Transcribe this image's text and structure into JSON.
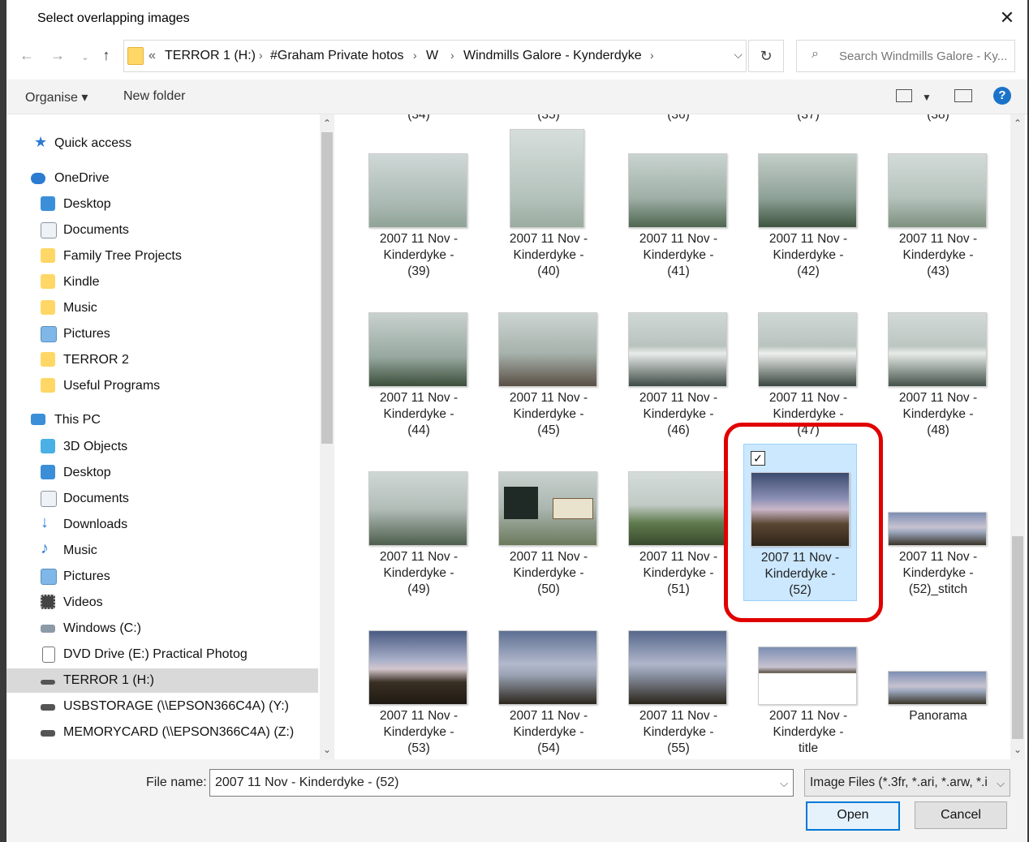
{
  "window": {
    "title": "Select overlapping images",
    "close_glyph": "✕"
  },
  "address_bar": {
    "overflow": "«",
    "crumbs": [
      "TERROR 1 (H:)",
      "#Graham Private hotos",
      "W",
      "Windmills Galore - Kynderdyke"
    ],
    "separator": "›"
  },
  "search": {
    "placeholder": "Search Windmills Galore - Ky..."
  },
  "toolbar": {
    "organise_label": "Organise ▾",
    "new_folder_label": "New folder",
    "help_label": "?"
  },
  "nav": {
    "items": [
      {
        "label": "Quick access",
        "icon": "star-icon"
      },
      {
        "label": "OneDrive",
        "icon": "cloud-icon"
      },
      {
        "label": "Desktop",
        "icon": "desktop-icon"
      },
      {
        "label": "Documents",
        "icon": "documents-icon"
      },
      {
        "label": "Family Tree Projects",
        "icon": "folder-icon"
      },
      {
        "label": "Kindle",
        "icon": "folder-icon"
      },
      {
        "label": "Music",
        "icon": "folder-icon"
      },
      {
        "label": "Pictures",
        "icon": "pictures-icon"
      },
      {
        "label": "TERROR 2",
        "icon": "folder-icon"
      },
      {
        "label": "Useful Programs",
        "icon": "folder-icon"
      },
      {
        "label": "This PC",
        "icon": "computer-icon"
      },
      {
        "label": "3D Objects",
        "icon": "cube-icon"
      },
      {
        "label": "Desktop",
        "icon": "desktop-icon"
      },
      {
        "label": "Documents",
        "icon": "documents-icon"
      },
      {
        "label": "Downloads",
        "icon": "download-icon"
      },
      {
        "label": "Music",
        "icon": "music-icon"
      },
      {
        "label": "Pictures",
        "icon": "pictures-icon"
      },
      {
        "label": "Videos",
        "icon": "video-icon"
      },
      {
        "label": "Windows (C:)",
        "icon": "drive-icon"
      },
      {
        "label": "DVD Drive (E:) Practical Photog",
        "icon": "dvd-icon"
      },
      {
        "label": "TERROR 1 (H:)",
        "icon": "drive-icon"
      },
      {
        "label": "USBSTORAGE (\\\\EPSON366C4A) (Y:)",
        "icon": "network-drive-icon"
      },
      {
        "label": "MEMORYCARD (\\\\EPSON366C4A) (Z:)",
        "icon": "network-drive-icon"
      }
    ]
  },
  "files": {
    "top_partial": [
      "(34)",
      "(35)",
      "(36)",
      "(37)",
      "(38)"
    ],
    "tiles": [
      {
        "l1": "2007 11 Nov -",
        "l2": "Kinderdyke  -",
        "l3": "(39)"
      },
      {
        "l1": "2007 11 Nov -",
        "l2": "Kinderdyke  -",
        "l3": "(40)"
      },
      {
        "l1": "2007 11 Nov -",
        "l2": "Kinderdyke  -",
        "l3": "(41)"
      },
      {
        "l1": "2007 11 Nov -",
        "l2": "Kinderdyke  -",
        "l3": "(42)"
      },
      {
        "l1": "2007 11 Nov -",
        "l2": "Kinderdyke  -",
        "l3": "(43)"
      },
      {
        "l1": "2007 11 Nov -",
        "l2": "Kinderdyke  -",
        "l3": "(44)"
      },
      {
        "l1": "2007 11 Nov -",
        "l2": "Kinderdyke  -",
        "l3": "(45)"
      },
      {
        "l1": "2007 11 Nov -",
        "l2": "Kinderdyke  -",
        "l3": "(46)"
      },
      {
        "l1": "2007 11 Nov -",
        "l2": "Kinderdyke  -",
        "l3": "(47)"
      },
      {
        "l1": "2007 11 Nov -",
        "l2": "Kinderdyke  -",
        "l3": "(48)"
      },
      {
        "l1": "2007 11 Nov -",
        "l2": "Kinderdyke  -",
        "l3": "(49)"
      },
      {
        "l1": "2007 11 Nov -",
        "l2": "Kinderdyke  -",
        "l3": "(50)"
      },
      {
        "l1": "2007 11 Nov -",
        "l2": "Kinderdyke  -",
        "l3": "(51)"
      },
      {
        "l1": "2007 11 Nov -",
        "l2": "Kinderdyke  -",
        "l3": "(52)",
        "selected": true
      },
      {
        "l1": "2007 11 Nov -",
        "l2": "Kinderdyke  -",
        "l3": "(52)_stitch"
      },
      {
        "l1": "2007 11 Nov -",
        "l2": "Kinderdyke  -",
        "l3": "(53)"
      },
      {
        "l1": "2007 11 Nov -",
        "l2": "Kinderdyke  -",
        "l3": "(54)"
      },
      {
        "l1": "2007 11 Nov -",
        "l2": "Kinderdyke  -",
        "l3": "(55)"
      },
      {
        "l1": "2007 11 Nov -",
        "l2": "Kinderdyke  -",
        "l3": "title"
      },
      {
        "l1": "Panorama",
        "l2": "",
        "l3": ""
      }
    ]
  },
  "footer": {
    "file_name_label": "File name:",
    "file_name_value": "2007 11 Nov - Kinderdyke  -  (52)",
    "file_type_value": "Image Files (*.3fr, *.ari, *.arw, *.i",
    "open_label": "Open",
    "cancel_label": "Cancel"
  },
  "colors": {
    "selection_bg": "#cce8ff",
    "highlight_box": "#e00000",
    "accent": "#0078d7"
  }
}
